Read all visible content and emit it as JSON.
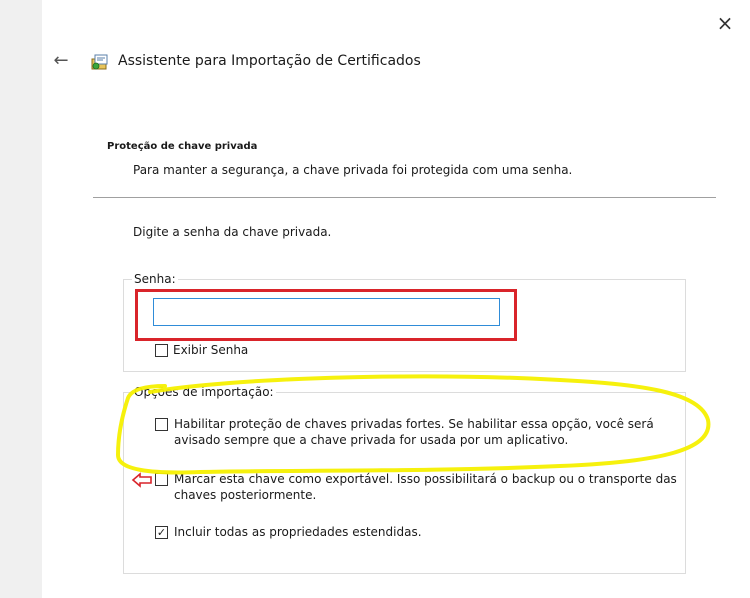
{
  "window": {
    "title": "Assistente para Importação de Certificados",
    "close_glyph": "×",
    "back_glyph": "←"
  },
  "header": {
    "heading": "Proteção de chave privada",
    "subtitle": "Para manter a segurança, a chave privada foi protegida com uma senha."
  },
  "body": {
    "prompt": "Digite a senha da chave privada."
  },
  "password_group": {
    "label": "Senha:",
    "input_value": "",
    "show_password": {
      "label": "Exibir Senha",
      "checked": false
    }
  },
  "options_group": {
    "label": "Opções de importação:",
    "options": [
      {
        "label": "Habilitar proteção de chaves privadas fortes. Se habilitar essa opção, você será avisado sempre que a chave privada for usada por um aplicativo.",
        "checked": false,
        "mark": ""
      },
      {
        "label": "Marcar esta chave como exportável. Isso possibilitará o backup ou o transporte das chaves posteriormente.",
        "checked": false,
        "mark": ""
      },
      {
        "label": "Incluir todas as propriedades estendidas.",
        "checked": true,
        "mark": "✓"
      }
    ]
  },
  "annotations": {
    "highlight_color": "#f5f000",
    "frame_color": "#d9242a"
  }
}
